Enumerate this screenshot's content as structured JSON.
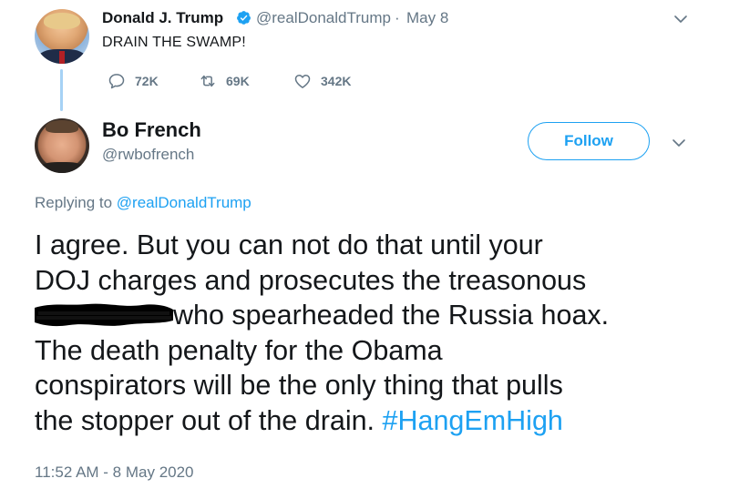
{
  "parent_tweet": {
    "display_name": "Donald J. Trump",
    "handle": "@realDonaldTrump",
    "separator": "·",
    "date": "May 8",
    "text": "DRAIN THE SWAMP!",
    "actions": {
      "replies": "72K",
      "retweets": "69K",
      "likes": "342K"
    },
    "verified_icon": "verified-badge-icon",
    "menu_icon": "chevron-down-icon"
  },
  "main_tweet": {
    "display_name": "Bo French",
    "handle": "@rwbofrench",
    "follow_label": "Follow",
    "replying_to_prefix": "Replying to",
    "replying_to_handle": "@realDonaldTrump",
    "lines": [
      "I agree. But you can not do that until your",
      "DOJ charges and prosecutes the treasonous",
      "who spearheaded the Russia hoax.",
      "The death penalty for the Obama",
      "conspirators will be the only thing that pulls",
      "the stopper out of the drain."
    ],
    "hashtag": "#HangEmHigh",
    "timestamp": "11:52 AM - 8 May 2020"
  },
  "colors": {
    "accent": "#1da1f2",
    "secondary_text": "#657786",
    "primary_text": "#14171a",
    "thread_line": "#a6d2f5"
  }
}
